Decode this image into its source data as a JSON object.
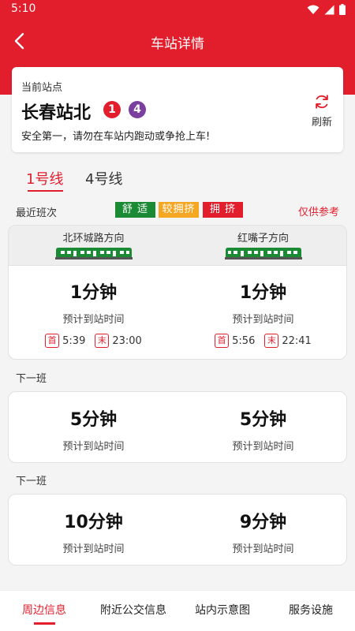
{
  "status_bar": {
    "time": "5:10"
  },
  "app_bar": {
    "title": "车站详情"
  },
  "station": {
    "label": "当前站点",
    "name": "长春站北",
    "lines": [
      "1",
      "4"
    ],
    "notice": "安全第一，请勿在车站内跑动或争抢上车!",
    "refresh_label": "刷新"
  },
  "line_tabs": [
    {
      "label": "1号线",
      "active": true
    },
    {
      "label": "4号线",
      "active": false
    }
  ],
  "recent": {
    "label": "最近班次",
    "legend": [
      "舒 适",
      "较拥挤",
      "拥 挤"
    ],
    "reference": "仅供参考"
  },
  "colors": {
    "primary": "#e21e2c",
    "comfortable": "#1b8a35",
    "crowded_moderate": "#f5a623",
    "crowded": "#e21e2c",
    "line4": "#7b3fa0"
  },
  "directions": [
    "北环城路方向",
    "红嘴子方向"
  ],
  "first_train": {
    "left": {
      "minutes": "1分钟",
      "sub": "预计到站时间",
      "first_label": "首",
      "first_time": "5:39",
      "last_label": "末",
      "last_time": "23:00"
    },
    "right": {
      "minutes": "1分钟",
      "sub": "预计到站时间",
      "first_label": "首",
      "first_time": "5:56",
      "last_label": "末",
      "last_time": "22:41"
    }
  },
  "next_trains": [
    {
      "label": "下一班",
      "left": {
        "minutes": "5分钟",
        "sub": "预计到站时间"
      },
      "right": {
        "minutes": "5分钟",
        "sub": "预计到站时间"
      }
    },
    {
      "label": "下一班",
      "left": {
        "minutes": "10分钟",
        "sub": "预计到站时间"
      },
      "right": {
        "minutes": "9分钟",
        "sub": "预计到站时间"
      }
    }
  ],
  "bottom_nav": [
    {
      "label": "周边信息",
      "active": true
    },
    {
      "label": "附近公交信息",
      "active": false
    },
    {
      "label": "站内示意图",
      "active": false
    },
    {
      "label": "服务设施",
      "active": false
    }
  ]
}
